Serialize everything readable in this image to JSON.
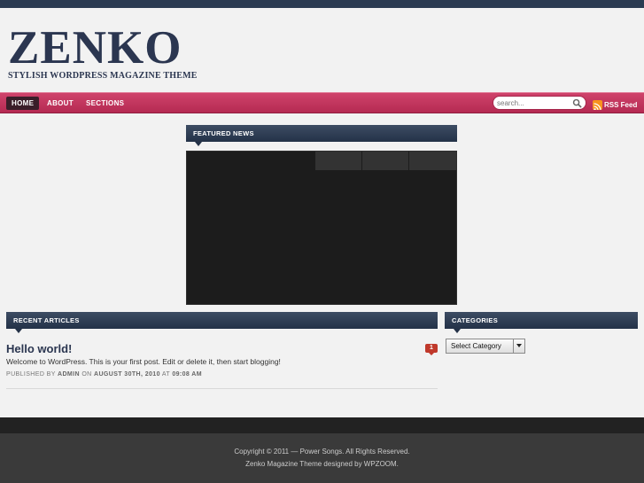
{
  "header": {
    "logo": "ZENKO",
    "tagline": "STYLISH WORDPRESS MAGAZINE THEME"
  },
  "nav": {
    "items": [
      "HOME",
      "ABOUT",
      "SECTIONS"
    ],
    "search_placeholder": "search...",
    "rss_label": "RSS Feed"
  },
  "featured": {
    "title": "FEATURED NEWS"
  },
  "recent": {
    "title": "RECENT ARTICLES",
    "post": {
      "title": "Hello world!",
      "excerpt": "Welcome to WordPress. This is your first post. Edit or delete it, then start blogging!",
      "meta_prefix": "PUBLISHED BY",
      "author": "ADMIN",
      "meta_on": "ON",
      "date": "AUGUST 30TH, 2010",
      "meta_at": "AT",
      "time": "09:08 AM",
      "comments": "1"
    }
  },
  "categories": {
    "title": "CATEGORIES",
    "selected": "Select Category"
  },
  "footer": {
    "copyright": "Copyright © 2011 — Power Songs. All Rights Reserved.",
    "credits": "Zenko Magazine Theme designed by WPZOOM."
  },
  "colors": {
    "accent": "#c03358",
    "navy": "#2b3650",
    "badge": "#c0392b"
  }
}
